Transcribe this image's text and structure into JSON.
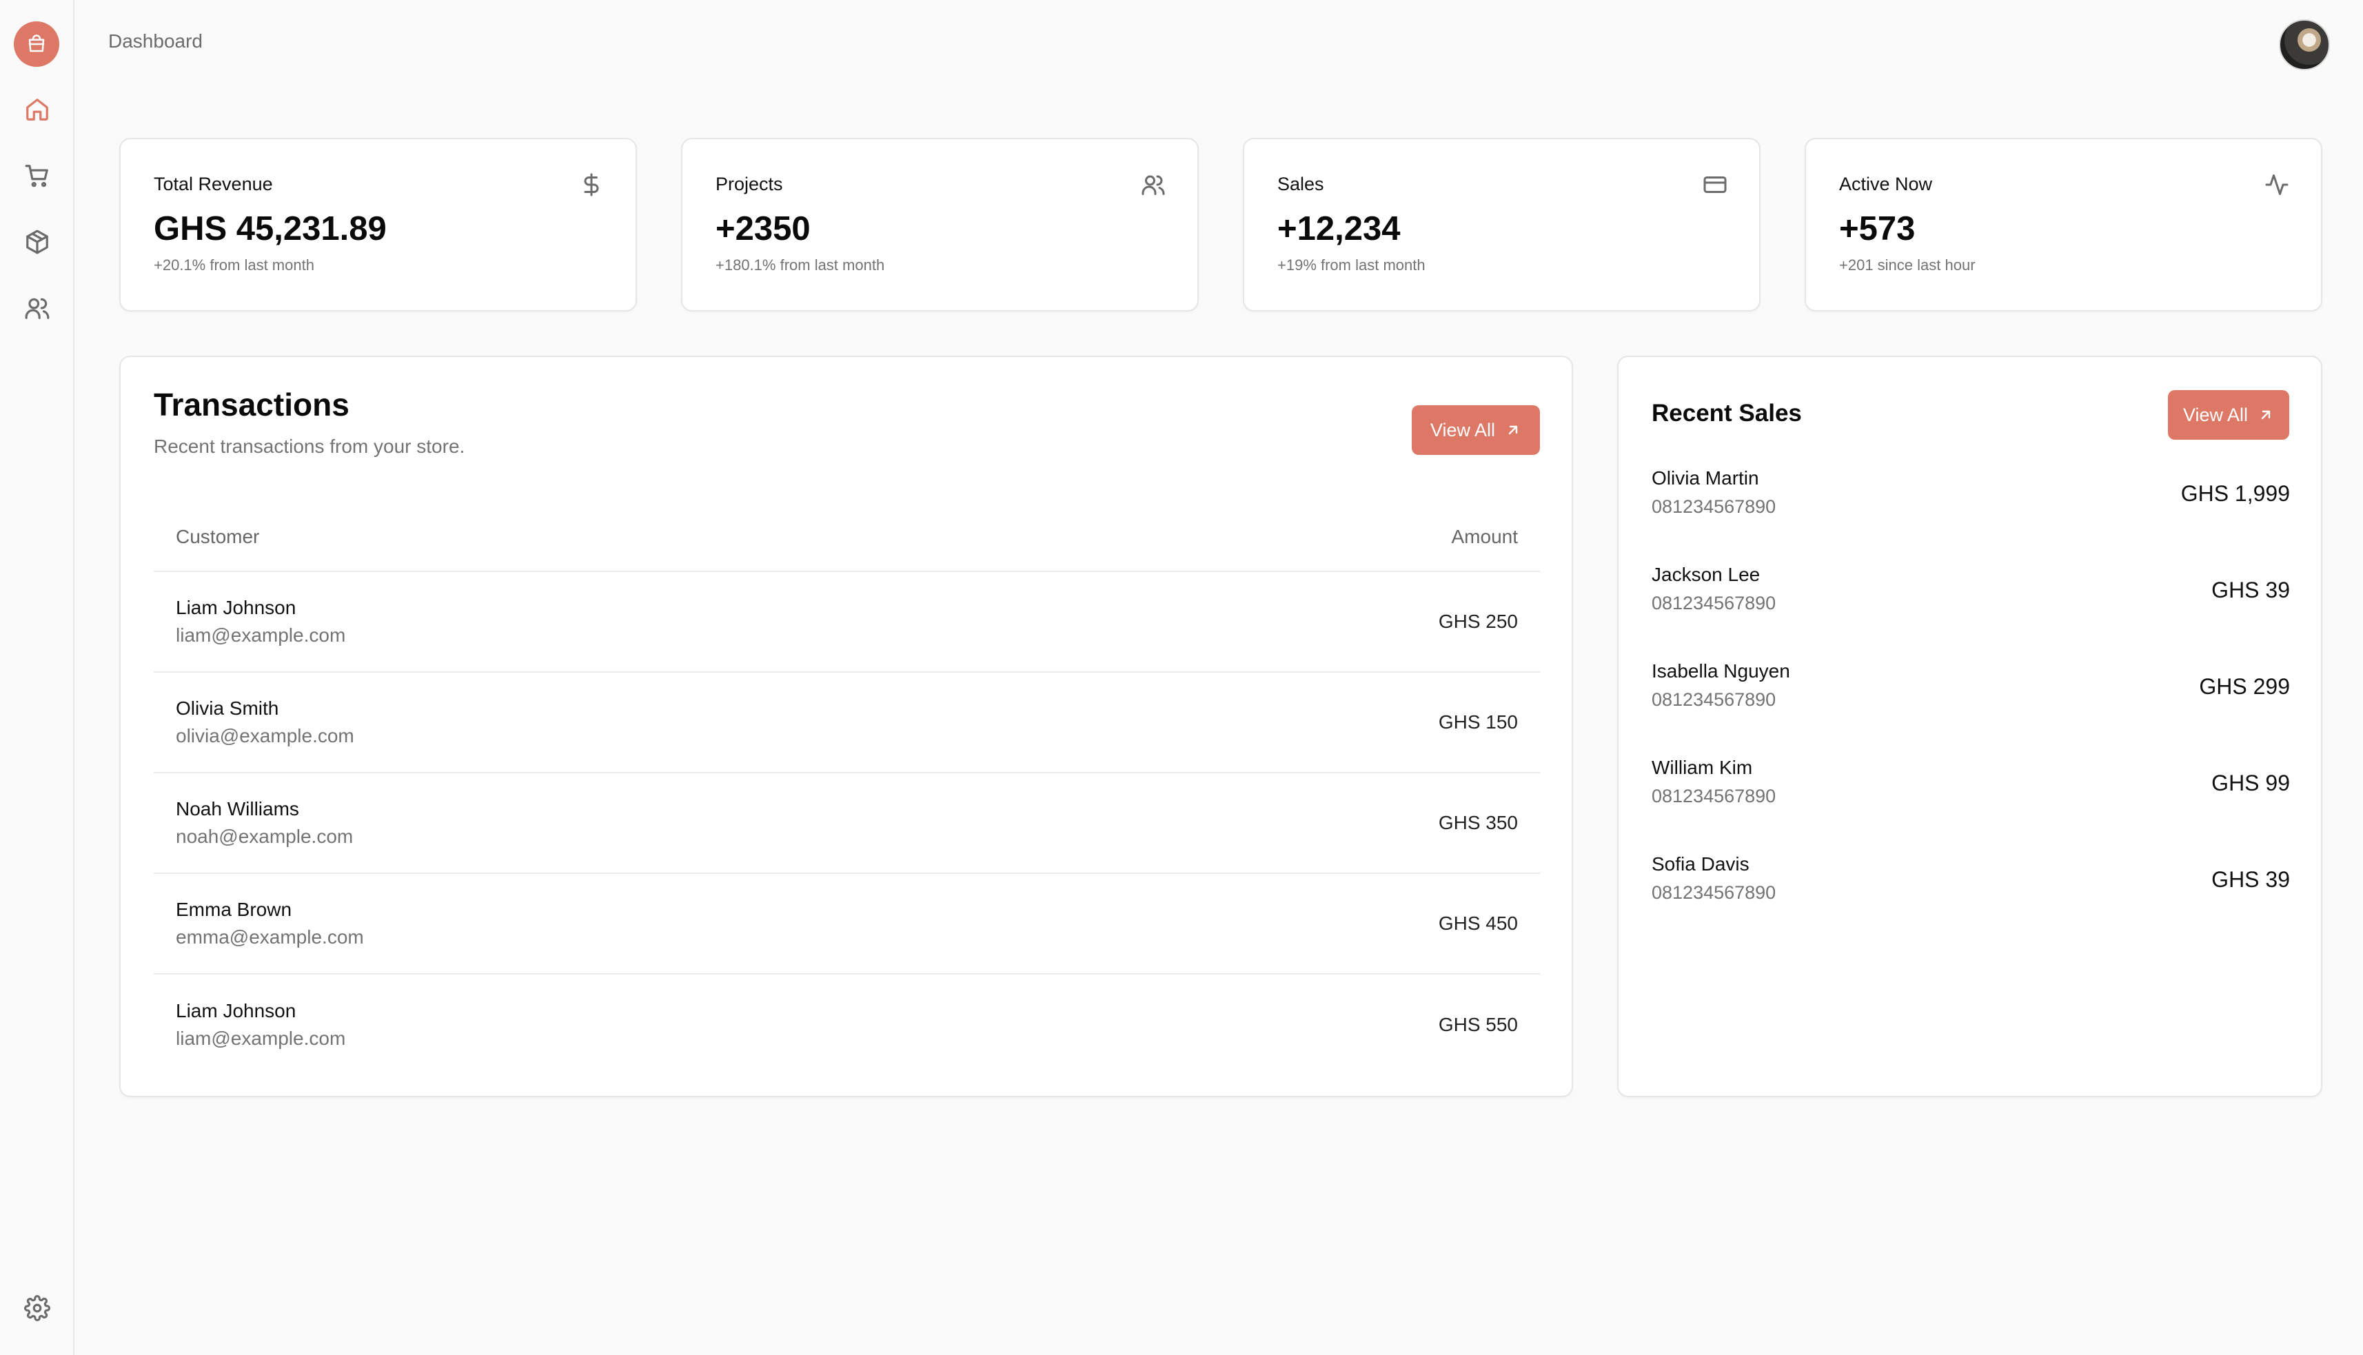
{
  "header": {
    "breadcrumb": "Dashboard"
  },
  "colors": {
    "accent": "#dd7866",
    "muted_text": "#737373",
    "border": "#e6e6e6"
  },
  "sidebar": {
    "items": [
      {
        "icon": "home-icon"
      },
      {
        "icon": "shopping-cart-icon"
      },
      {
        "icon": "package-icon"
      },
      {
        "icon": "users-icon"
      }
    ],
    "footer_icon": "settings-icon"
  },
  "stats": [
    {
      "title": "Total Revenue",
      "value": "GHS 45,231.89",
      "sub": "+20.1% from last month",
      "icon": "dollar-icon"
    },
    {
      "title": "Projects",
      "value": "+2350",
      "sub": "+180.1% from last month",
      "icon": "users-icon"
    },
    {
      "title": "Sales",
      "value": "+12,234",
      "sub": "+19% from last month",
      "icon": "credit-card-icon"
    },
    {
      "title": "Active Now",
      "value": "+573",
      "sub": "+201 since last hour",
      "icon": "activity-icon"
    }
  ],
  "transactions": {
    "title": "Transactions",
    "description": "Recent transactions from your store.",
    "view_all_label": "View All",
    "columns": {
      "customer": "Customer",
      "amount": "Amount"
    },
    "rows": [
      {
        "name": "Liam Johnson",
        "email": "liam@example.com",
        "amount": "GHS 250"
      },
      {
        "name": "Olivia Smith",
        "email": "olivia@example.com",
        "amount": "GHS 150"
      },
      {
        "name": "Noah Williams",
        "email": "noah@example.com",
        "amount": "GHS 350"
      },
      {
        "name": "Emma Brown",
        "email": "emma@example.com",
        "amount": "GHS 450"
      },
      {
        "name": "Liam Johnson",
        "email": "liam@example.com",
        "amount": "GHS 550"
      }
    ]
  },
  "recent_sales": {
    "title": "Recent Sales",
    "view_all_label": "View All",
    "items": [
      {
        "name": "Olivia Martin",
        "phone": "081234567890",
        "amount": "GHS 1,999"
      },
      {
        "name": "Jackson Lee",
        "phone": "081234567890",
        "amount": "GHS 39"
      },
      {
        "name": "Isabella Nguyen",
        "phone": "081234567890",
        "amount": "GHS 299"
      },
      {
        "name": "William Kim",
        "phone": "081234567890",
        "amount": "GHS 99"
      },
      {
        "name": "Sofia Davis",
        "phone": "081234567890",
        "amount": "GHS 39"
      }
    ]
  }
}
